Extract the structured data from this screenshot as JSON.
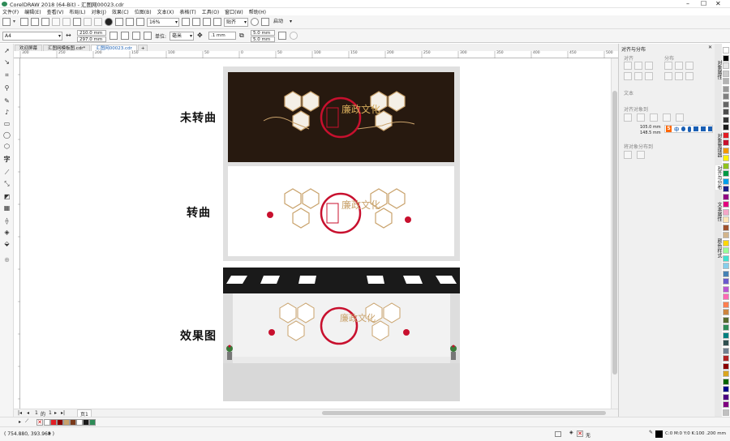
{
  "window": {
    "title": "CorelDRAW 2018 (64-Bit) - 汇图网00023.cdr"
  },
  "menu": [
    "文件(F)",
    "编辑(E)",
    "查看(V)",
    "布局(L)",
    "对象(J)",
    "效果(C)",
    "位图(B)",
    "文本(X)",
    "表格(T)",
    "工具(O)",
    "窗口(W)",
    "帮助(H)"
  ],
  "toolbar": {
    "zoom": "16%",
    "snap_label": "贴齐",
    "launch_label": "启动"
  },
  "propbar": {
    "page_size": "A4",
    "width": "210.0 mm",
    "height": "297.0 mm",
    "units_label": "单位:",
    "units": "毫米",
    "nudge": ".1 mm",
    "dup_x": "5.0 mm",
    "dup_y": "5.0 mm"
  },
  "tabs": [
    "欢迎屏幕",
    "汇图网模板图.cdr*",
    "汇图网00023.cdr"
  ],
  "ruler_ticks": [
    "300",
    "250",
    "200",
    "150",
    "100",
    "50",
    "0",
    "50",
    "100",
    "150",
    "200",
    "250",
    "300",
    "350",
    "400",
    "450",
    "500"
  ],
  "canvas_labels": {
    "untranslated": "未转曲",
    "converted": "转曲",
    "effect": "效果图"
  },
  "artwork_title": "廉政文化",
  "panel": {
    "title": "对齐与分布",
    "section_align": "对齐",
    "section_distribute": "分布",
    "section_text": "文本",
    "section_align_objects": "对齐对象到",
    "section_spacing": "将对象分布到",
    "coord_x": "105.0 mm",
    "coord_y": "148.5 mm"
  },
  "panel_tabs": [
    "对象属性",
    "对象管理器",
    "对齐与分布",
    "文本属性",
    "颜色样式"
  ],
  "ime_bar": {
    "label": "中"
  },
  "pages": {
    "current": "1",
    "of_label": "的",
    "total": "1",
    "page_tab": "页1"
  },
  "status": {
    "coords": "( 754.880, 393.968 )",
    "fill_none": "无",
    "color_info": "C:0 M:0 Y:0 K:100 .200 mm"
  },
  "palette_colors": [
    "#ffffff",
    "#000000",
    "#e6e6e6",
    "#cccccc",
    "#b3b3b3",
    "#999999",
    "#808080",
    "#666666",
    "#4d4d4d",
    "#333333",
    "#1a1a1a",
    "#e31e24",
    "#c8102e",
    "#f39800",
    "#fff100",
    "#8fc31f",
    "#009944",
    "#00a0e9",
    "#1d2088",
    "#920783",
    "#e4007f",
    "#f5a6c7",
    "#ffe4b5",
    "#a0522d",
    "#d2b48c",
    "#ffd700",
    "#98fb98",
    "#40e0d0",
    "#87ceeb",
    "#4682b4",
    "#6a5acd",
    "#ba55d3",
    "#ff69b4",
    "#ff7f50",
    "#cd853f",
    "#556b2f",
    "#2e8b57",
    "#008080",
    "#2f4f4f",
    "#708090",
    "#b22222",
    "#8b0000",
    "#daa520",
    "#006400",
    "#00008b",
    "#4b0082",
    "#800080",
    "#c0c0c0"
  ],
  "bottom_swatches": [
    "#ffffff",
    "#e31e24",
    "#8b0000",
    "#c9a26b",
    "#7a3a1a",
    "#ffffff",
    "#1a1a1a",
    "#2e8b57"
  ]
}
